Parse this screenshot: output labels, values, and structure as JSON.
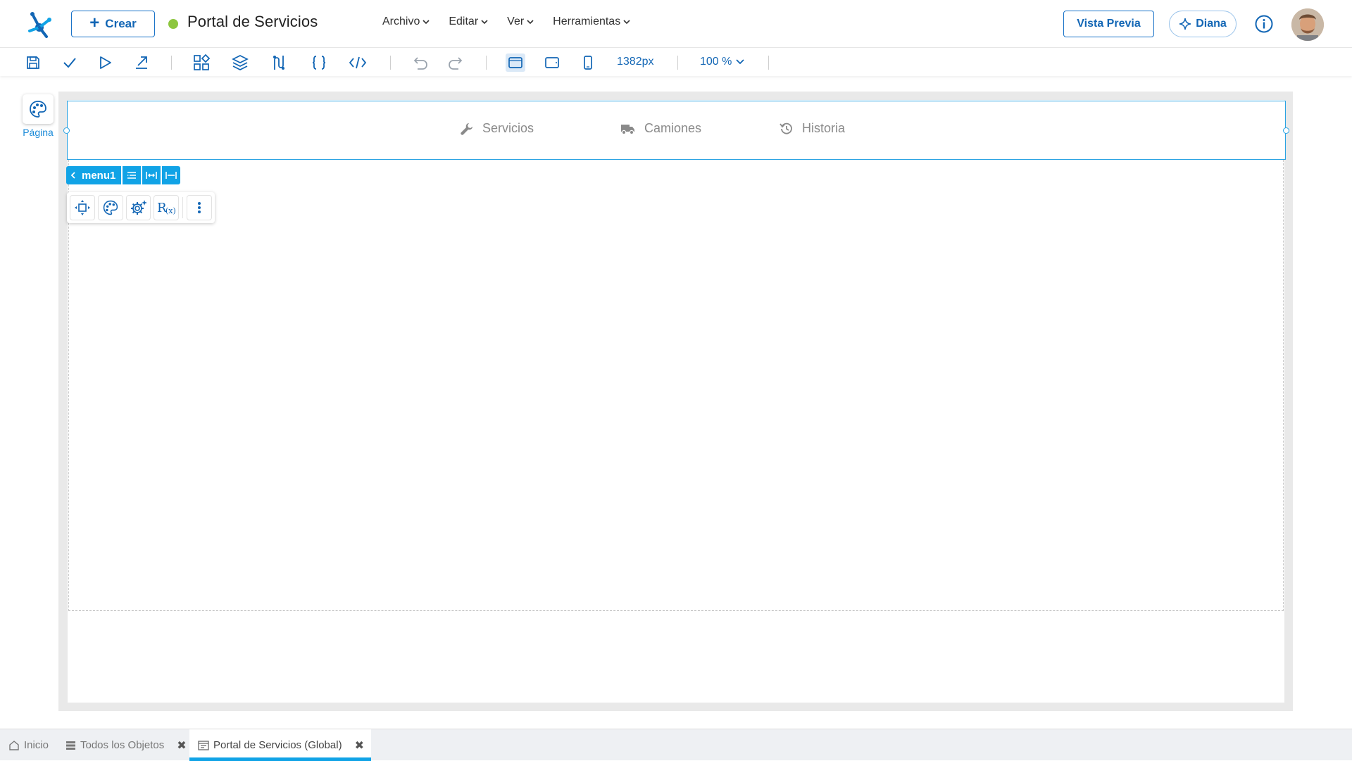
{
  "header": {
    "create_label": "Crear",
    "app_title": "Portal de Servicios",
    "status_color": "#8dc63f",
    "menu": [
      {
        "label": "Archivo"
      },
      {
        "label": "Editar"
      },
      {
        "label": "Ver"
      },
      {
        "label": "Herramientas"
      }
    ],
    "preview_label": "Vista Previa",
    "assistant_label": "Diana"
  },
  "toolbar": {
    "width_value": "1382px",
    "zoom_value": "100 %"
  },
  "palette": {
    "page_label": "Página"
  },
  "canvas": {
    "menu_items": [
      {
        "label": "Servicios",
        "icon": "wrench-icon"
      },
      {
        "label": "Camiones",
        "icon": "truck-icon"
      },
      {
        "label": "Historia",
        "icon": "history-icon"
      }
    ],
    "component_name": "menu1"
  },
  "bottom_tabs": [
    {
      "label": "Inicio",
      "icon": "home-icon"
    },
    {
      "label": "Todos los Objetos",
      "icon": "list-icon"
    },
    {
      "label": "Portal de Servicios (Global)",
      "icon": "page-icon"
    }
  ],
  "colors": {
    "accent": "#1266b5",
    "selection": "#2ba3e3",
    "tag": "#11a3e6"
  }
}
